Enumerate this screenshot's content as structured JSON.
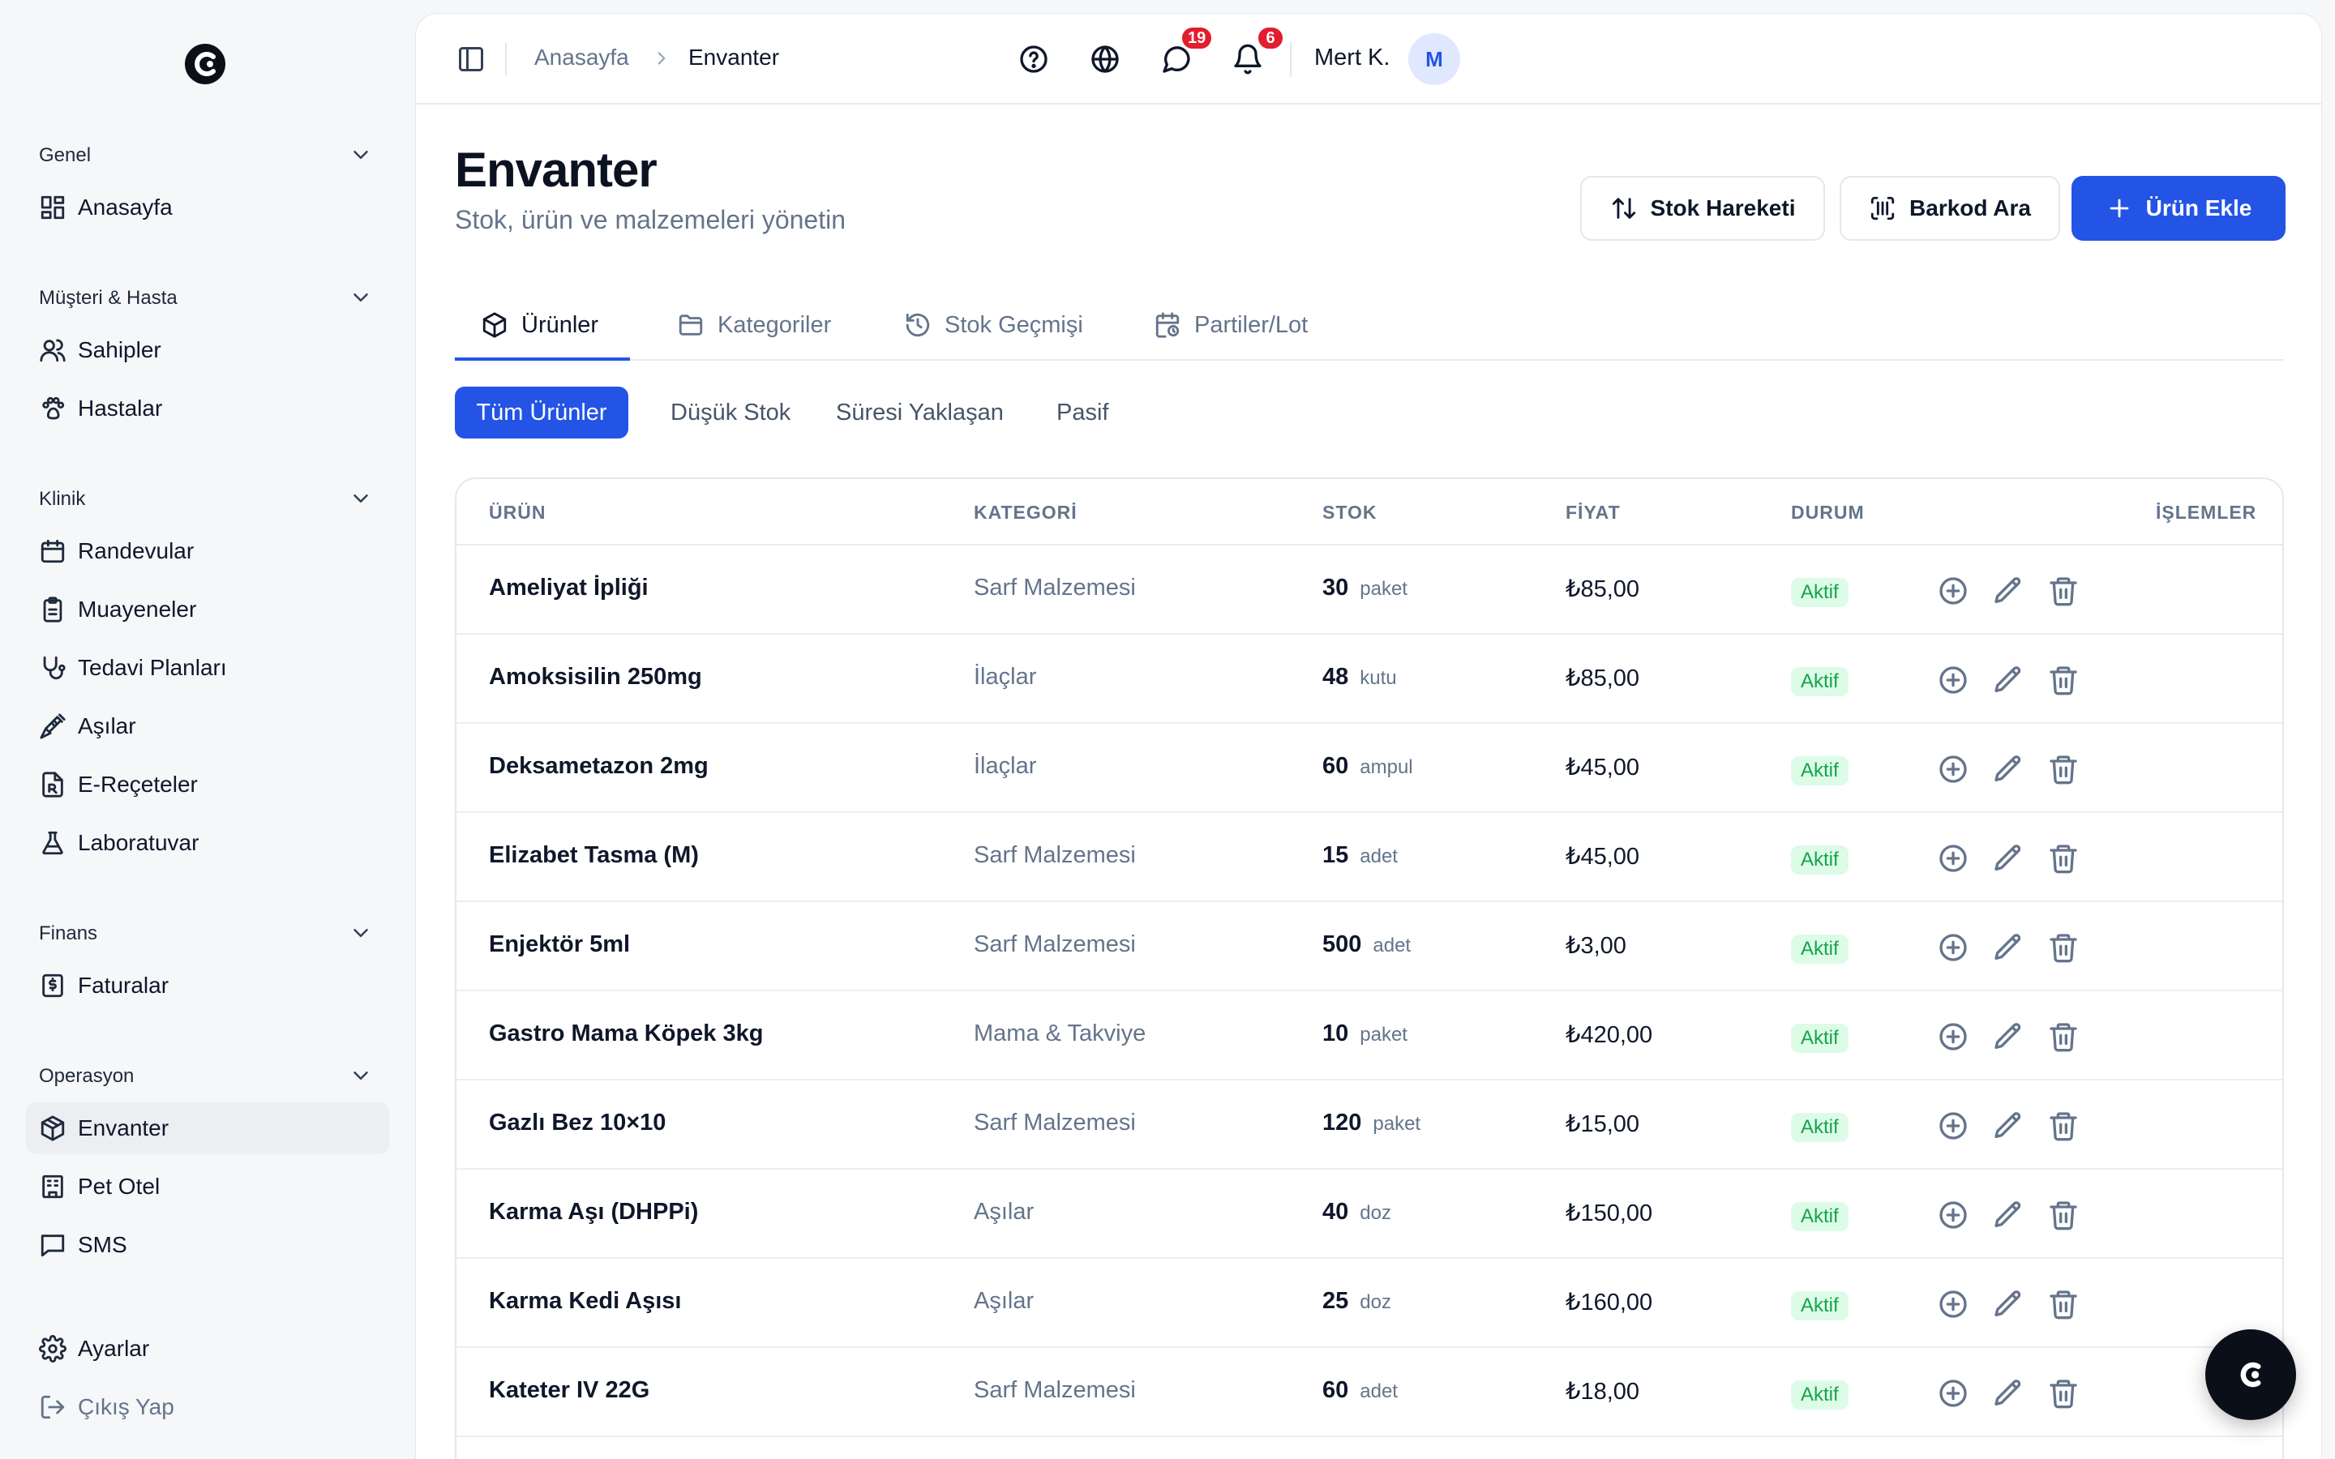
{
  "brand": {
    "logo_icon": "brand-logo-icon"
  },
  "sidebar": {
    "sections": [
      {
        "title": "Genel",
        "items": [
          {
            "label": "Anasayfa",
            "icon": "dashboard-icon"
          }
        ]
      },
      {
        "title": "Müşteri & Hasta",
        "items": [
          {
            "label": "Sahipler",
            "icon": "users-icon"
          },
          {
            "label": "Hastalar",
            "icon": "paw-icon"
          }
        ]
      },
      {
        "title": "Klinik",
        "items": [
          {
            "label": "Randevular",
            "icon": "calendar-icon"
          },
          {
            "label": "Muayeneler",
            "icon": "clipboard-icon"
          },
          {
            "label": "Tedavi Planları",
            "icon": "stethoscope-icon"
          },
          {
            "label": "Aşılar",
            "icon": "syringe-icon"
          },
          {
            "label": "E-Reçeteler",
            "icon": "prescription-icon"
          },
          {
            "label": "Laboratuvar",
            "icon": "flask-icon"
          }
        ]
      },
      {
        "title": "Finans",
        "items": [
          {
            "label": "Faturalar",
            "icon": "invoice-icon"
          }
        ]
      },
      {
        "title": "Operasyon",
        "items": [
          {
            "label": "Envanter",
            "icon": "package-icon",
            "active": true
          },
          {
            "label": "Pet Otel",
            "icon": "hotel-icon"
          },
          {
            "label": "SMS",
            "icon": "message-icon"
          }
        ]
      }
    ],
    "footer": [
      {
        "label": "Ayarlar",
        "icon": "gear-icon"
      },
      {
        "label": "Çıkış Yap",
        "icon": "logout-icon"
      }
    ]
  },
  "topbar": {
    "breadcrumb": [
      "Anasayfa",
      "Envanter"
    ],
    "messages_badge": "19",
    "notifications_badge": "6",
    "user_name": "Mert K.",
    "user_initial": "M"
  },
  "page": {
    "title": "Envanter",
    "subtitle": "Stok, ürün ve malzemeleri yönetin",
    "buttons": {
      "stock_movement": "Stok Hareketi",
      "barcode": "Barkod Ara",
      "add_product": "Ürün Ekle"
    },
    "tabs": [
      "Ürünler",
      "Kategoriler",
      "Stok Geçmişi",
      "Partiler/Lot"
    ],
    "filters": [
      "Tüm Ürünler",
      "Düşük Stok",
      "Süresi Yaklaşan",
      "Pasif"
    ]
  },
  "table": {
    "headers": [
      "ÜRÜN",
      "KATEGORİ",
      "STOK",
      "FİYAT",
      "DURUM",
      "İŞLEMLER"
    ],
    "rows": [
      {
        "name": "Ameliyat İpliği",
        "category": "Sarf Malzemesi",
        "stock": "30",
        "unit": "paket",
        "price": "₺85,00",
        "status": "Aktif"
      },
      {
        "name": "Amoksisilin 250mg",
        "category": "İlaçlar",
        "stock": "48",
        "unit": "kutu",
        "price": "₺85,00",
        "status": "Aktif"
      },
      {
        "name": "Deksametazon 2mg",
        "category": "İlaçlar",
        "stock": "60",
        "unit": "ampul",
        "price": "₺45,00",
        "status": "Aktif"
      },
      {
        "name": "Elizabet Tasma (M)",
        "category": "Sarf Malzemesi",
        "stock": "15",
        "unit": "adet",
        "price": "₺45,00",
        "status": "Aktif"
      },
      {
        "name": "Enjektör 5ml",
        "category": "Sarf Malzemesi",
        "stock": "500",
        "unit": "adet",
        "price": "₺3,00",
        "status": "Aktif"
      },
      {
        "name": "Gastro Mama Köpek 3kg",
        "category": "Mama & Takviye",
        "stock": "10",
        "unit": "paket",
        "price": "₺420,00",
        "status": "Aktif"
      },
      {
        "name": "Gazlı Bez 10×10",
        "category": "Sarf Malzemesi",
        "stock": "120",
        "unit": "paket",
        "price": "₺15,00",
        "status": "Aktif"
      },
      {
        "name": "Karma Aşı (DHPPi)",
        "category": "Aşılar",
        "stock": "40",
        "unit": "doz",
        "price": "₺150,00",
        "status": "Aktif"
      },
      {
        "name": "Karma Kedi Aşısı",
        "category": "Aşılar",
        "stock": "25",
        "unit": "doz",
        "price": "₺160,00",
        "status": "Aktif"
      },
      {
        "name": "Kateter IV 22G",
        "category": "Sarf Malzemesi",
        "stock": "60",
        "unit": "adet",
        "price": "₺18,00",
        "status": "Aktif"
      }
    ]
  },
  "colors": {
    "primary": "#2354e6",
    "status_active_bg": "#dcfce7",
    "status_active_text": "#16a34a",
    "badge": "#e11d2e"
  }
}
